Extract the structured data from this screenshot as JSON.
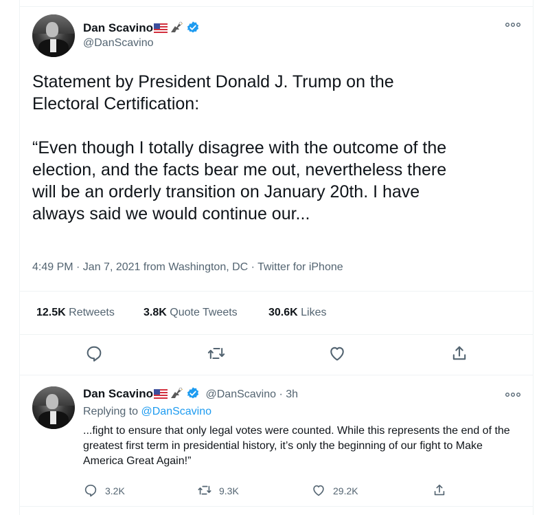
{
  "main_tweet": {
    "name": "Dan Scavino",
    "handle": "@DanScavino",
    "text": "Statement by President Donald J. Trump on the\nElectoral Certification:\n\n“Even though I totally disagree with the outcome of the\nelection, and the facts bear me out, nevertheless there\nwill be an orderly transition on January 20th. I have\nalways said we would continue our...",
    "meta": "4:49 PM · Jan 7, 2021 from Washington, DC · Twitter for iPhone",
    "stats": {
      "retweets_count": "12.5K",
      "retweets_label": "Retweets",
      "quotes_count": "3.8K",
      "quotes_label": "Quote Tweets",
      "likes_count": "30.6K",
      "likes_label": "Likes"
    }
  },
  "reply_tweet": {
    "name": "Dan Scavino",
    "handle": "@DanScavino",
    "time": "· 3h",
    "replying_prefix": "Replying to",
    "replying_to": "@DanScavino",
    "text": "...fight to ensure that only legal votes were counted. While this represents the end of the greatest first term in presidential history, it’s only the beginning of our fight to Make America Great Again!”",
    "reply_count": "3.2K",
    "retweet_count": "9.3K",
    "like_count": "29.2K"
  },
  "icons": [
    "more-icon",
    "verified-icon",
    "us-flag-icon",
    "eagle-icon",
    "reply-icon",
    "retweet-icon",
    "like-icon",
    "share-icon"
  ],
  "colors": {
    "accent": "#1d9bf0",
    "secondary_text": "#536471",
    "primary_text": "#0f1419"
  }
}
